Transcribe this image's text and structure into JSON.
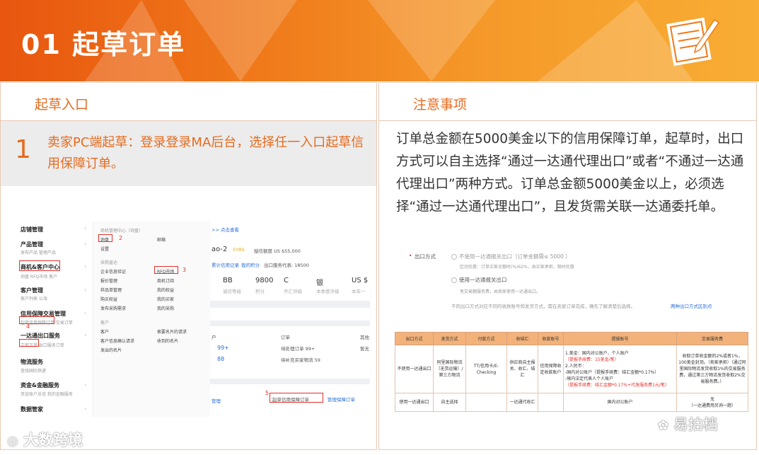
{
  "header": {
    "title": "01 起草订单"
  },
  "left": {
    "heading": "起草入口",
    "step_num": "1",
    "step_text": "卖家PC端起草：登录登录MA后台，选择任一入口起草信用保障订单。"
  },
  "right": {
    "heading": "注意事项",
    "note": "订单总金额在5000美金以下的信用保障订单，起草时，出口方式可以自主选择“通过一达通代理出口”或者“不通过一达通代理出口”两种方式。订单总金额5000美金以上，必须选择“通过一达通代理出口”，且发货需关联一达通委托单。"
  },
  "screenshot": {
    "sidebar": [
      {
        "label": "店铺管理",
        "sub": ""
      },
      {
        "label": "产品管理",
        "sub": "发布产品  管理产品"
      },
      {
        "label": "商机&客户中心",
        "sub": "询盘  RFQ市场  客户"
      },
      {
        "label": "客户管理",
        "sub": "客户列表  公海"
      },
      {
        "label": "信用保障交易管理",
        "sub": "起草信用保障订单  交易订单"
      },
      {
        "label": "一达通出口服务",
        "sub": "立即下单  出口服务订单"
      },
      {
        "label": "物流服务",
        "sub": "查找国际快递"
      },
      {
        "label": "资金&金融服务",
        "sub": "资金账户总览  我的金融服务"
      },
      {
        "label": "数据管家",
        "sub": ""
      }
    ],
    "dropdown": {
      "col1": [
        "商机管理中心（询盘）",
        "询盘",
        "设置",
        "采购直达",
        "企业信息验证",
        "报价管理",
        "样品单管理",
        "购买权益",
        "发布采购需求",
        "客户",
        "客户",
        "客户信息确认请求",
        "发出的名片"
      ],
      "col2": [
        "邮箱",
        "RFQ市场",
        "商机订阅",
        "我的权益",
        "我的买家",
        "我的采购",
        "索要名片的请求",
        "收到的名片"
      ]
    },
    "main": {
      "link": ">> 点击查看",
      "account": "ao-2",
      "badge": "5YRS",
      "credit": "授信额度 US $55,000",
      "tabs": [
        "累计信用记录",
        "我的积分",
        "出口服务代表: 18500"
      ],
      "stats": [
        "BB",
        "9800",
        "C",
        "银",
        "US $"
      ],
      "stat_labels": [
        "诚信等级",
        "积分",
        "开汇评级",
        "本季度评级",
        "本年一"
      ],
      "col_heads": [
        "户",
        "订单",
        "其他"
      ],
      "rows": [
        "99+",
        "待处理订单 99+",
        "88",
        "待补充买家物流 59",
        "暂无"
      ],
      "bottom": [
        "管理",
        "起草信用保障订单",
        "管理保障订单"
      ],
      "nums": [
        "2",
        "3",
        "4",
        "5"
      ]
    }
  },
  "options": {
    "label": "出口方式",
    "opt1": "不使用一达通报关出口（订单金额需≤ 5000        ）",
    "opt1_note": "区动优惠：订单买家全额时(%)62%，由买家承担，限时优惠",
    "opt2": "使用一达通报关出口",
    "opt2_note": "免交易额服务费，由卖家使用一达通出口。",
    "footer": "不同出口方式对应不同的收款账号和发货方式，需在卖家订单完成，确先了解清楚后选择。",
    "footer_link": "两种出口方式区别点"
  },
  "table": {
    "headers": [
      "出口方式",
      "发货方式",
      "付款方式",
      "收结汇",
      "收款账号",
      "提报账号",
      "交易服务费"
    ],
    "row1": [
      "不使用一达通出口",
      "阿里国际物流（无货运输）/第三方物流",
      "TT/信用卡/E-Checking",
      "供应商自主报关、收汇、结汇",
      "信用保障收定收款账户",
      "1.美金：国内对公账户、个人账户",
      "（提报手续费：15美金/笔）",
      "2.人民币：",
      "-国内对公账户（提报手续费：结汇金额*0.17%）",
      "-境内法定代表人个人账户",
      "（提报手续费：结汇金额*0.17%+代发服务费1元/笔）",
      "收取订单收金额的2%或者1%，100美金封顶。（卖家承担）（通过阿里国际物流发货收取1%的交易服务费，通过第三方物流发货收取2%交易服务费。）"
    ],
    "row2": [
      "使用一达通出口",
      "自主选择",
      "",
      "一达通代收汇",
      "",
      "国内对公账户",
      "无",
      "（一达通费用另询一题）"
    ]
  },
  "watermarks": {
    "left": "大数跨境",
    "right": "易拍档"
  },
  "colors": {
    "accent": "#e56b1f",
    "red": "#e0302a",
    "banner": "#f07a1a"
  }
}
